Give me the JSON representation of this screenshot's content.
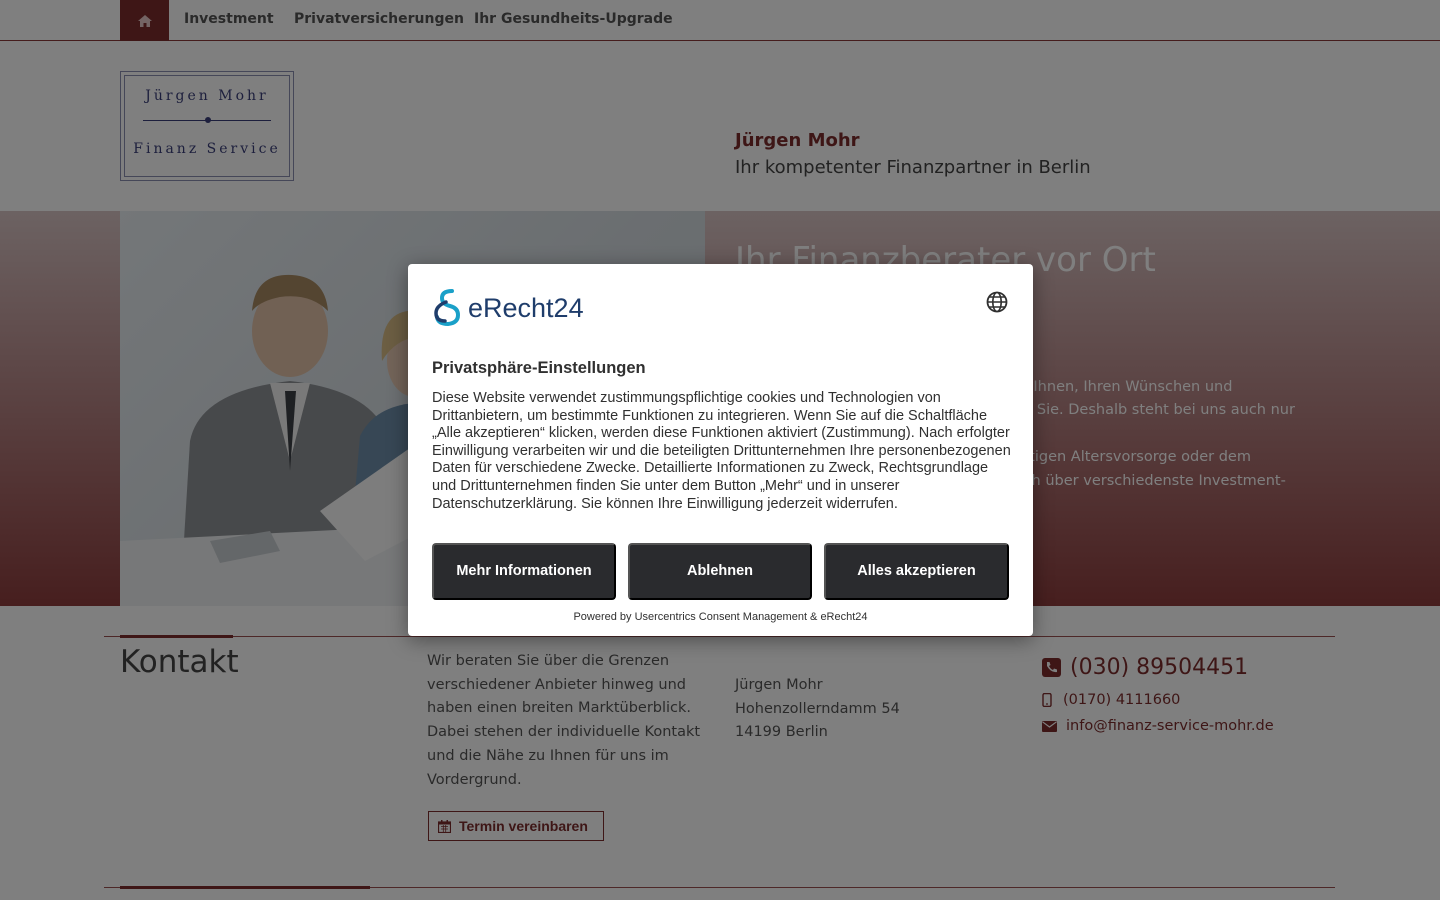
{
  "nav": {
    "home_icon": "home-icon",
    "items": [
      {
        "label": "Investment"
      },
      {
        "label": "Privatversicherungen"
      },
      {
        "label": "Ihr Gesundheits-Upgrade"
      }
    ]
  },
  "header": {
    "logo_line1": "Jürgen Mohr",
    "logo_line2": "Finanz Service",
    "name": "Jürgen Mohr",
    "tagline": "Ihr kompetenter Finanzpartner in Berlin"
  },
  "hero": {
    "title": "Ihr Finanzberater vor Ort",
    "text_lines": [
      "zu Ihnen, Ihren Wünschen und",
      "für Sie. Deshalb steht bei uns auch nur",
      "chtigen Altersvorsorge oder dem",
      "sich über verschiedenste Investment-"
    ]
  },
  "kontakt": {
    "title": "Kontakt",
    "text": "Wir beraten Sie über die Grenzen verschiedener Anbieter hinweg und haben einen breiten Marktüberblick. Dabei stehen der individuelle Kontakt und die Nähe zu Ihnen für uns im Vordergrund.",
    "button_label": "Termin vereinbaren",
    "address": {
      "name": "Jürgen Mohr",
      "street": "Hohenzollerndamm 54",
      "city": "14199 Berlin"
    },
    "phone": "(030) 89504451",
    "mobile": "(0170) 4111660",
    "email": "info@finanz-service-mohr.de"
  },
  "consent": {
    "brand": "eRecht24",
    "title": "Privatsphäre-Einstellungen",
    "text": "Diese Website verwendet zustimmungspflichtige cookies und Technologien von Drittanbietern, um bestimmte Funktionen zu integrieren. Wenn Sie auf die Schaltfläche „Alle akzeptieren“ klicken, werden diese Funktionen aktiviert (Zustimmung). Nach erfolgter Einwilligung verarbeiten wir und die beteiligten Drittunternehmen Ihre personenbezogenen Daten für verschiedene Zwecke. Detaillierte Informationen zu Zweck, Rechtsgrundlage und Drittunternehmen finden Sie unter dem Button „Mehr“ und in unserer Datenschutzerklärung. Sie können Ihre Einwilligung jederzeit widerrufen.",
    "buttons": {
      "more": "Mehr Informationen",
      "decline": "Ablehnen",
      "accept": "Alles akzeptieren"
    },
    "powered_by": "Powered by Usercentrics Consent Management & eRecht24"
  },
  "colors": {
    "accent": "#7d2c2c",
    "dialog_button": "#2a2b2e",
    "brand_blue": "#1f3d6b",
    "brand_teal": "#1aa0c8"
  }
}
